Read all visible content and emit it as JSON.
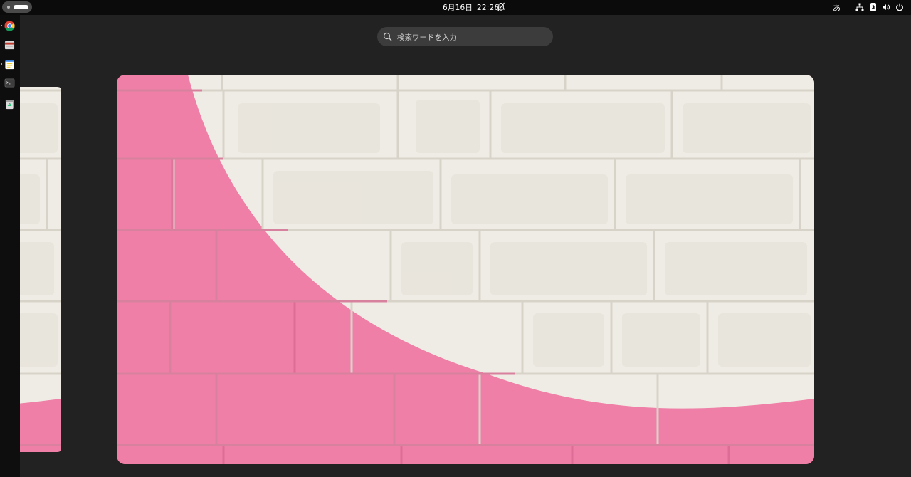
{
  "topbar": {
    "clock_date": "6月16日",
    "clock_time": "22:26",
    "input_method": "あ"
  },
  "search": {
    "placeholder": "検索ワードを入力"
  },
  "dock": {
    "items": [
      {
        "name": "Chrome"
      },
      {
        "name": "Files"
      },
      {
        "name": "Text Editor"
      },
      {
        "name": "Terminal"
      },
      {
        "name": "Trash"
      }
    ]
  },
  "colors": {
    "panel": "#0b0b0b",
    "overview_bg": "#222222",
    "wall_white": "#efece5",
    "wall_pink": "#ef7fa6"
  },
  "icons": {
    "activities": "activities-pill",
    "notifications": "bell-off-icon",
    "network": "network-icon",
    "bluetooth": "bluetooth-icon",
    "volume": "volume-icon",
    "power": "power-icon",
    "search": "search-icon"
  }
}
